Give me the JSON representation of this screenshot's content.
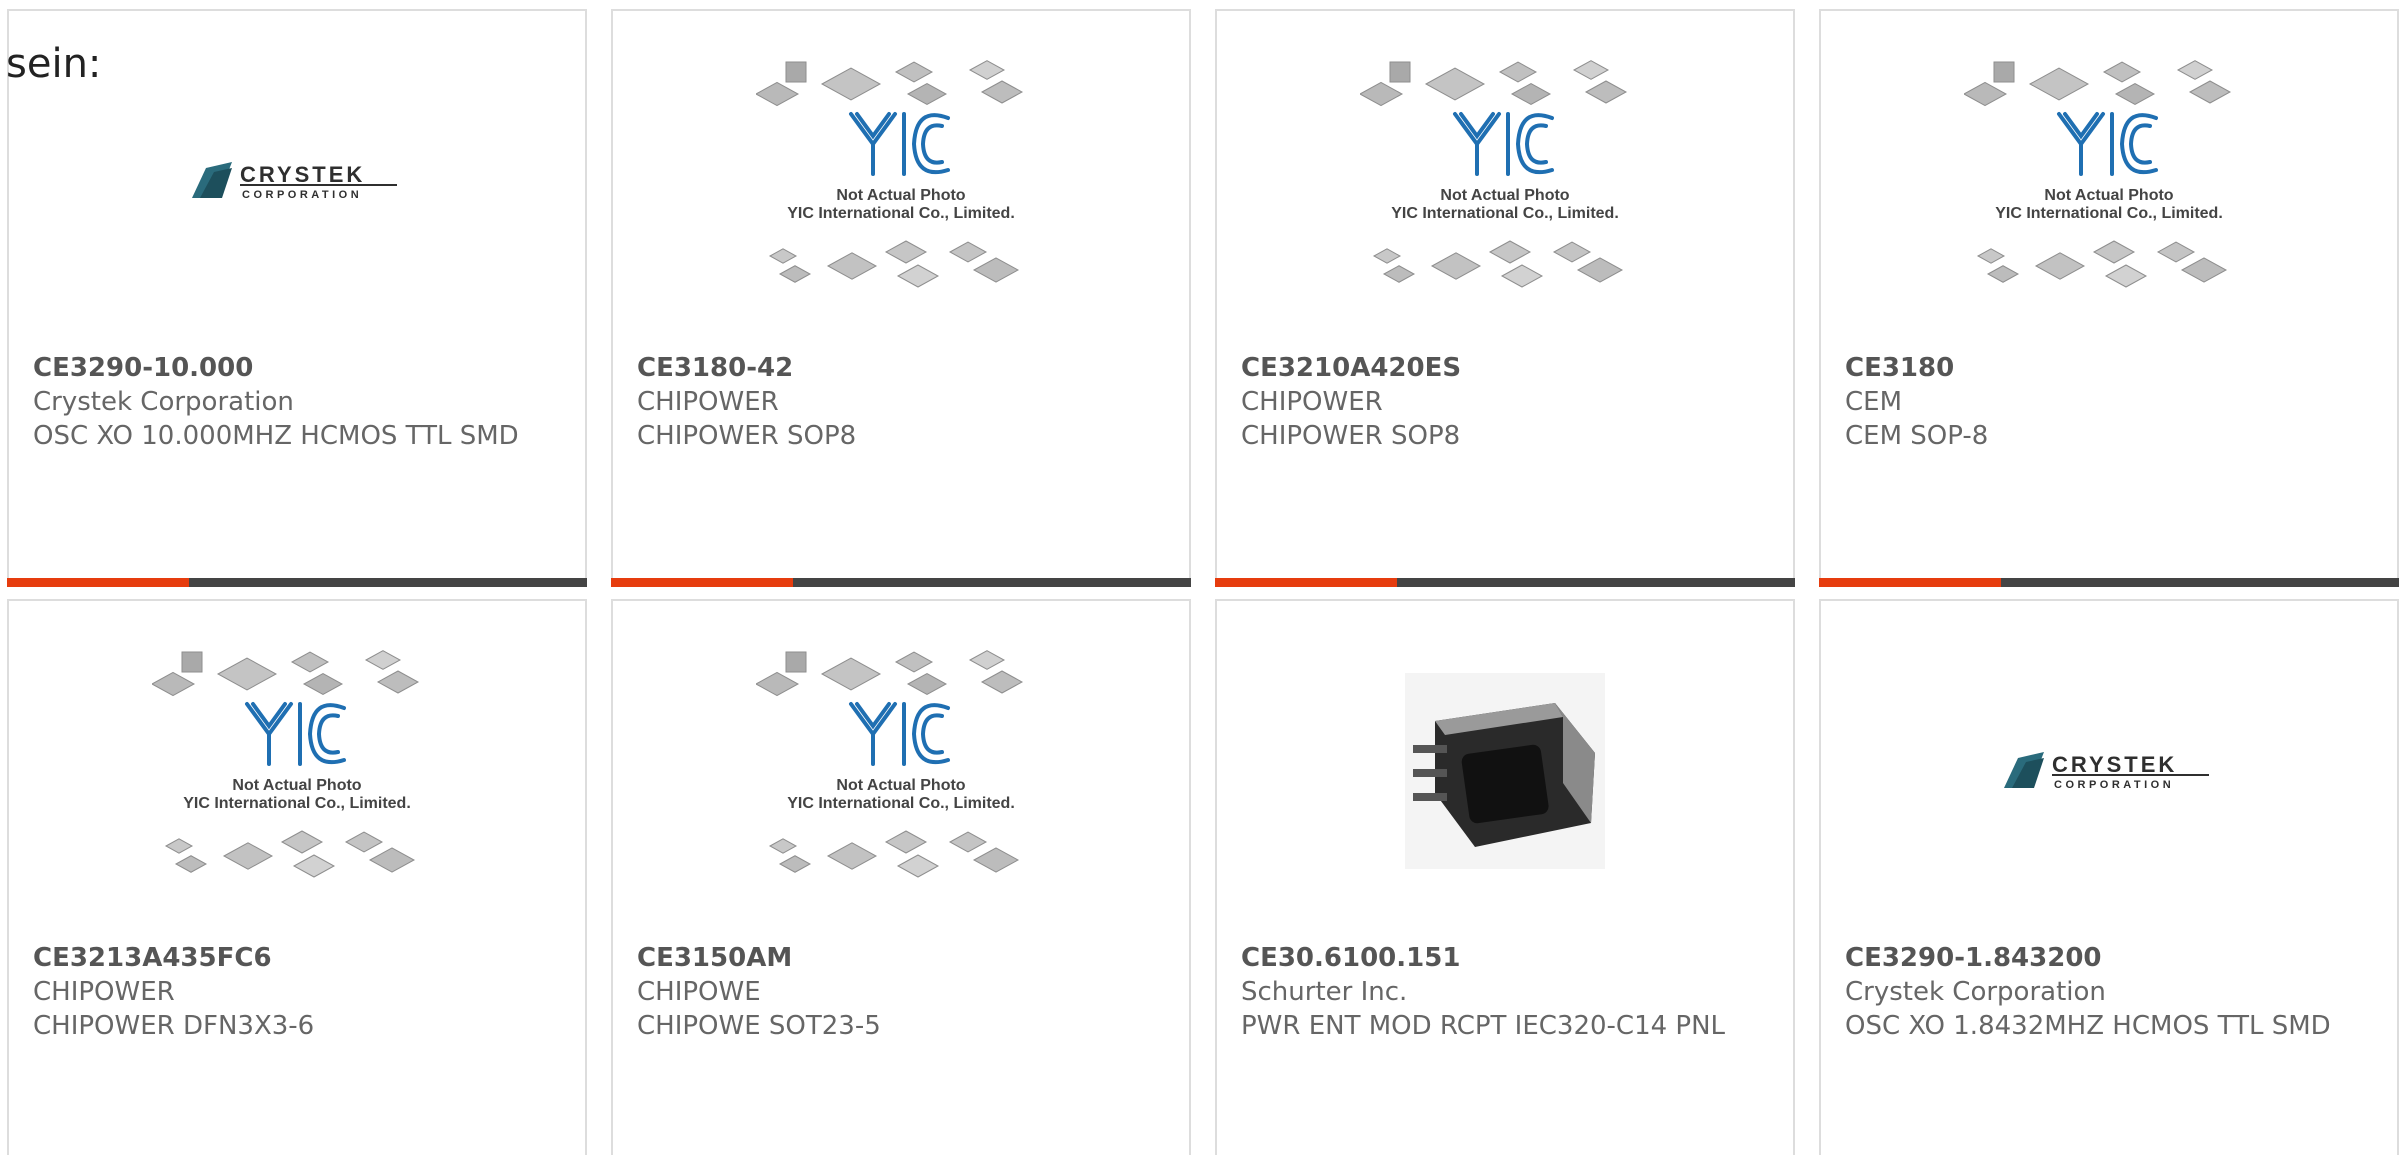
{
  "intro_text": "sein:",
  "placeholder_image": {
    "line1": "Not Actual Photo",
    "line2": "YIC International Co., Limited.",
    "logo": "YIC"
  },
  "crystek_logo": {
    "name": "CRYSTEK",
    "sub": "CORPORATION"
  },
  "accent_color": "#e63c0e",
  "bar_color": "#444444",
  "products": [
    {
      "part_number": "CE3290-10.000",
      "manufacturer": "Crystek Corporation",
      "description": "OSC XO 10.000MHZ HCMOS TTL SMD",
      "image": "crystek-logo"
    },
    {
      "part_number": "CE3180-42",
      "manufacturer": "CHIPOWER",
      "description": "CHIPOWER SOP8",
      "image": "yic-placeholder"
    },
    {
      "part_number": "CE3210A420ES",
      "manufacturer": "CHIPOWER",
      "description": "CHIPOWER SOP8",
      "image": "yic-placeholder"
    },
    {
      "part_number": "CE3180",
      "manufacturer": "CEM",
      "description": "CEM SOP-8",
      "image": "yic-placeholder"
    },
    {
      "part_number": "CE3213A435FC6",
      "manufacturer": "CHIPOWER",
      "description": "CHIPOWER DFN3X3-6",
      "image": "yic-placeholder"
    },
    {
      "part_number": "CE3150AM",
      "manufacturer": "CHIPOWE",
      "description": "CHIPOWE SOT23-5",
      "image": "yic-placeholder"
    },
    {
      "part_number": "CE30.6100.151",
      "manufacturer": "Schurter Inc.",
      "description": "PWR ENT MOD RCPT IEC320-C14 PNL",
      "image": "power-entry-module"
    },
    {
      "part_number": "CE3290-1.843200",
      "manufacturer": "Crystek Corporation",
      "description": "OSC XO 1.8432MHZ HCMOS TTL SMD",
      "image": "crystek-logo"
    }
  ]
}
